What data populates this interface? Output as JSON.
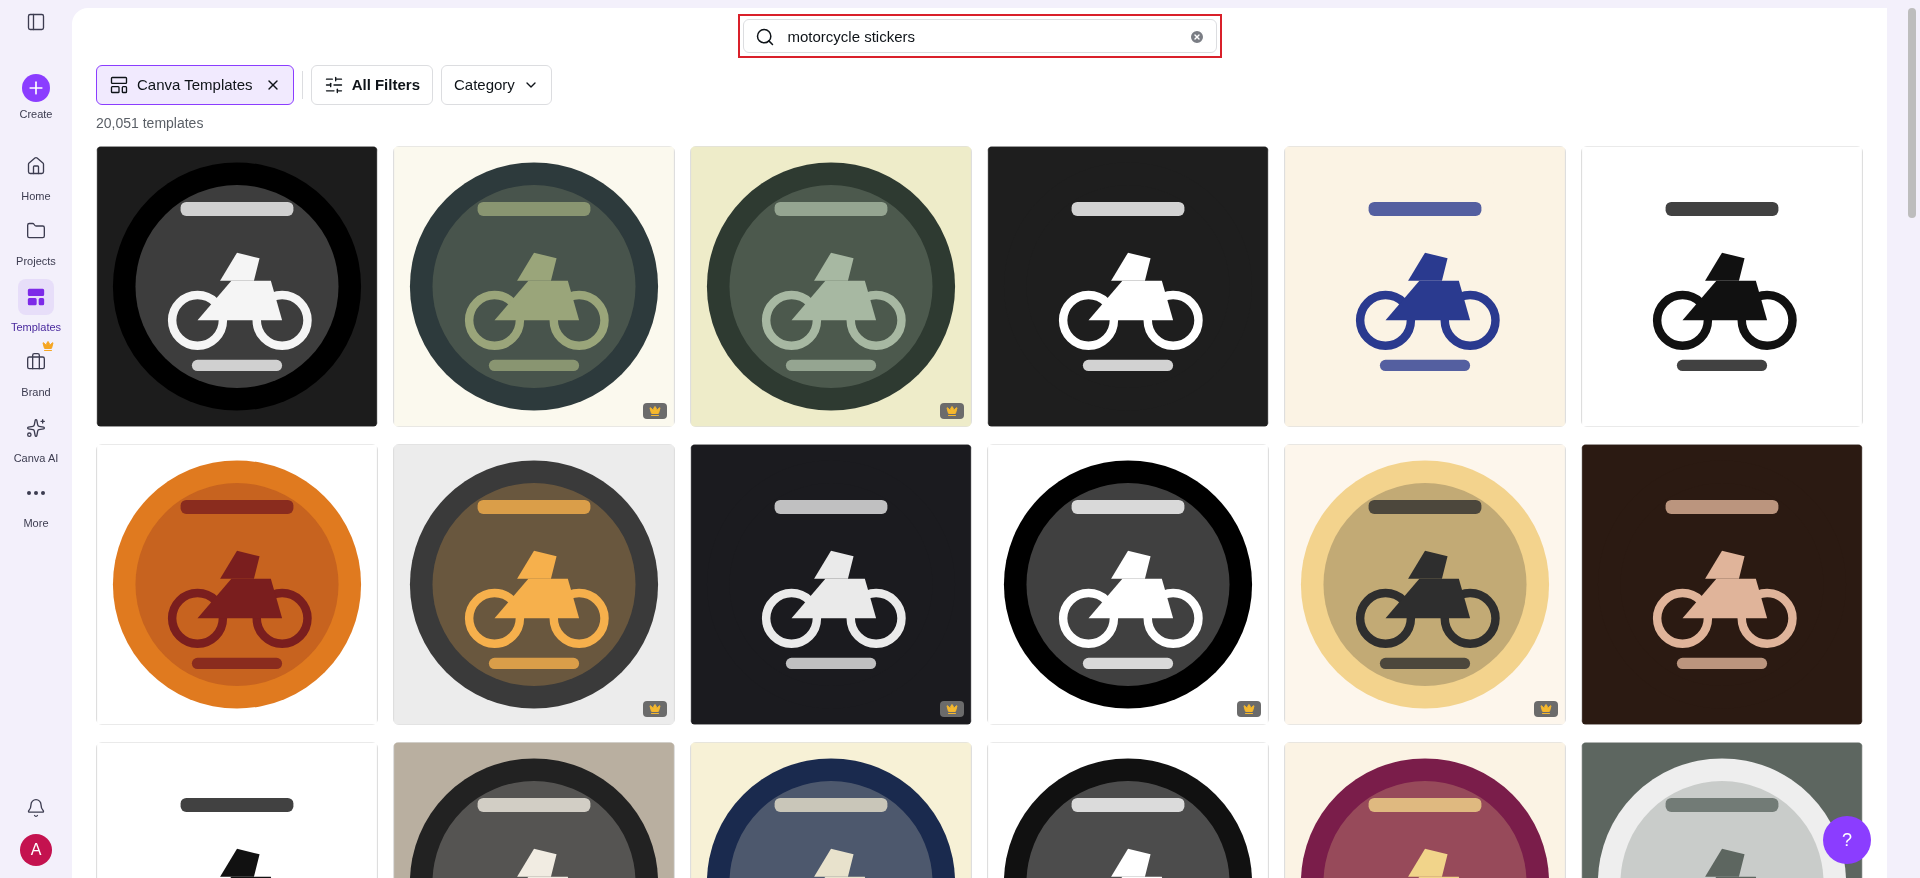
{
  "sidebar": {
    "items": [
      {
        "kind": "create",
        "label": "Create",
        "selected": false
      },
      {
        "kind": "home",
        "label": "Home",
        "selected": false
      },
      {
        "kind": "projects",
        "label": "Projects",
        "selected": false
      },
      {
        "kind": "templates",
        "label": "Templates",
        "selected": true
      },
      {
        "kind": "brand",
        "label": "Brand",
        "selected": false,
        "premium": true
      },
      {
        "kind": "ai",
        "label": "Canva AI",
        "selected": false
      },
      {
        "kind": "more",
        "label": "More",
        "selected": false
      }
    ],
    "avatar": "A"
  },
  "search": {
    "value": "motorcycle stickers"
  },
  "filters": [
    {
      "kind": "chip",
      "label": "Canva Templates",
      "selected": true
    },
    {
      "kind": "filters",
      "label": "All Filters",
      "selected": false
    },
    {
      "kind": "dropdown",
      "label": "Category",
      "selected": false
    }
  ],
  "count": "20,051 templates",
  "templates": [
    {
      "kind": "picture",
      "premium": false
    },
    {
      "kind": "picture",
      "premium": true
    },
    {
      "kind": "picture",
      "premium": true
    },
    {
      "kind": "picture",
      "premium": false
    },
    {
      "kind": "picture",
      "premium": false
    },
    {
      "kind": "picture",
      "premium": false
    },
    {
      "kind": "picture",
      "premium": false
    },
    {
      "kind": "picture",
      "premium": true
    },
    {
      "kind": "picture",
      "premium": true
    },
    {
      "kind": "picture",
      "premium": true
    },
    {
      "kind": "picture",
      "premium": true
    },
    {
      "kind": "picture",
      "premium": false
    },
    {
      "kind": "picture",
      "premium": false
    },
    {
      "kind": "picture",
      "premium": false
    },
    {
      "kind": "picture",
      "premium": false
    },
    {
      "kind": "picture",
      "premium": false
    },
    {
      "kind": "picture",
      "premium": false
    },
    {
      "kind": "picture",
      "premium": false
    }
  ],
  "help": "?"
}
